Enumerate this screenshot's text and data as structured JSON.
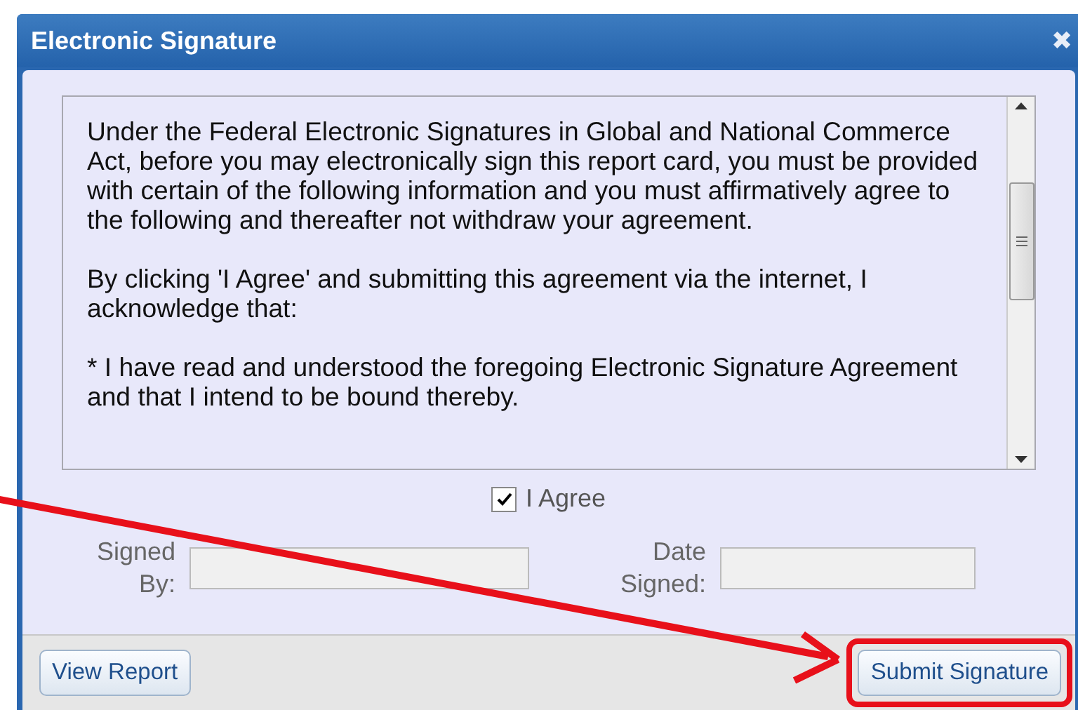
{
  "window": {
    "title": "Electronic Signature",
    "close": "✖"
  },
  "agreement": {
    "paragraphs": [
      "Under the Federal Electronic Signatures in Global and National Commerce Act, before you may electronically sign this report card, you must be provided with certain of the following information and you must affirmatively agree to the following and thereafter not withdraw your agreement.",
      "By clicking 'I Agree' and submitting this agreement via the internet, I acknowledge that:",
      "* I have read and understood the foregoing Electronic Signature Agreement and that I intend to be bound thereby."
    ]
  },
  "agree": {
    "label": "I Agree",
    "checked": true
  },
  "fields": [
    {
      "label": "Signed By:"
    },
    {
      "label": "Date Signed:"
    }
  ],
  "buttons": [
    {
      "label": "View Report",
      "highlighted": false
    },
    {
      "label": "Submit Signature",
      "highlighted": true
    }
  ]
}
